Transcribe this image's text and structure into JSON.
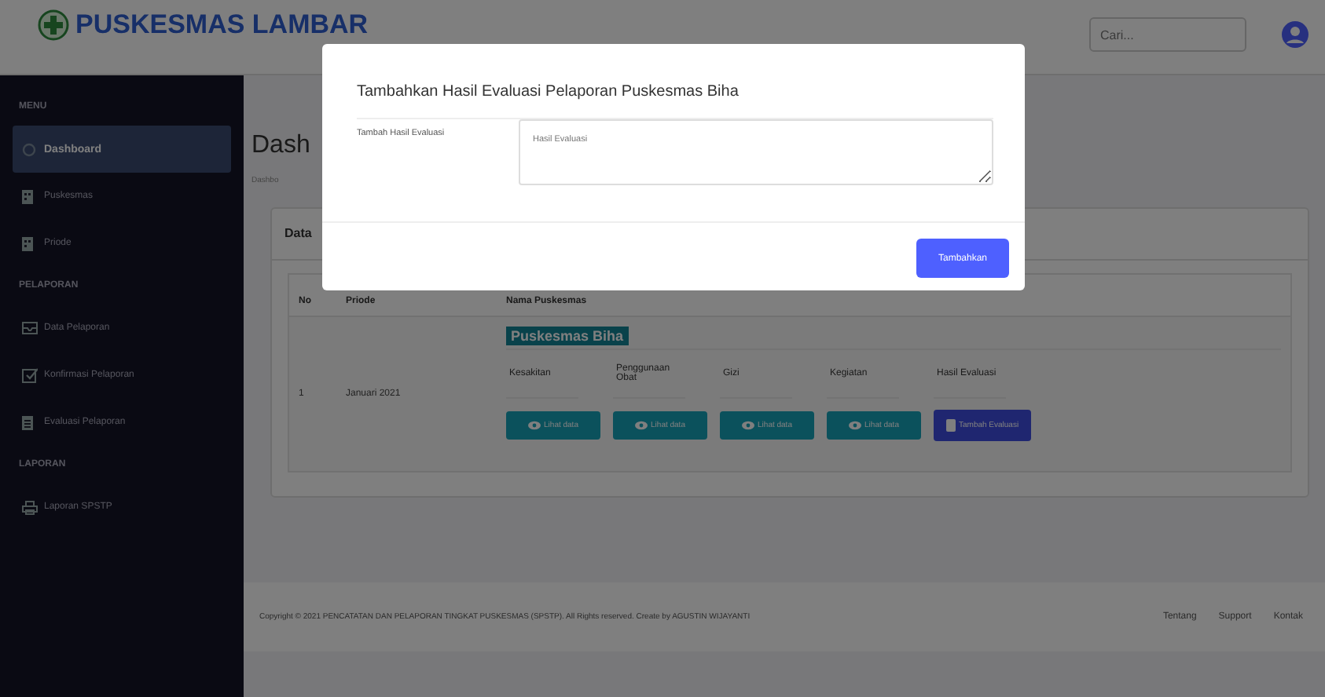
{
  "header": {
    "logo": "PUSKESMAS LAMBAR",
    "search": {
      "placeholder": "Cari..."
    }
  },
  "sidebar": {
    "items": [
      {
        "kind": "heading",
        "label": "MENU"
      },
      {
        "kind": "link",
        "label": "Dashboard",
        "selected": true
      },
      {
        "kind": "link",
        "label": "Puskesmas",
        "selected": false
      },
      {
        "kind": "link",
        "label": "Priode",
        "selected": false
      },
      {
        "kind": "heading",
        "label": "PELAPORAN"
      },
      {
        "kind": "link",
        "label": "Data Pelaporan",
        "selected": false
      },
      {
        "kind": "link",
        "label": "Konfirmasi Pelaporan",
        "selected": false
      },
      {
        "kind": "link",
        "label": "Evaluasi Pelaporan",
        "selected": false
      },
      {
        "kind": "heading",
        "label": "LAPORAN"
      },
      {
        "kind": "link",
        "label": "Laporan SPSTP",
        "selected": false
      }
    ]
  },
  "page": {
    "title": "Dash",
    "breadcrumb": "Dashbo"
  },
  "card": {
    "title": "Data",
    "table": {
      "columns": [
        "No",
        "Priode",
        "Nama Puskesmas"
      ],
      "rows": [
        {
          "no": "1",
          "period": "Januari 2021",
          "puskesmas": "Puskesmas Biha",
          "subcolumns": [
            {
              "label": "Kesakitan",
              "button": "Lihat data",
              "kind": "view"
            },
            {
              "label": "Penggunaan Obat",
              "button": "Lihat data",
              "kind": "view"
            },
            {
              "label": "Gizi",
              "button": "Lihat data",
              "kind": "view"
            },
            {
              "label": "Kegiatan",
              "button": "Lihat data",
              "kind": "view"
            },
            {
              "label": "Hasil Evaluasi",
              "button": "Tambah Evaluasi",
              "kind": "add"
            }
          ]
        }
      ]
    }
  },
  "footer": {
    "copyright": "Copyright © 2021 PENCATATAN DAN PELAPORAN TINGKAT PUSKESMAS (SPSTP). All Rights reserved. Create by AGUSTIN WIJAYANTI",
    "links": [
      "Tentang",
      "Support",
      "Kontak"
    ]
  },
  "modal": {
    "title": "Tambahkan Hasil Evaluasi Pelaporan Puskesmas Biha",
    "label": "Tambah Hasil Evaluasi",
    "textarea": {
      "placeholder": "Hasil Evaluasi"
    },
    "button": "Tambahkan"
  }
}
